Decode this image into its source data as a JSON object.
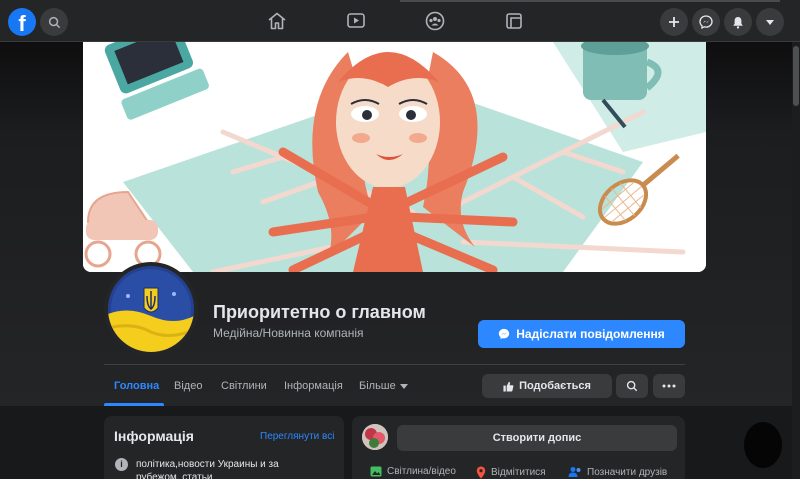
{
  "page": {
    "name": "Приоритетно о главном",
    "category": "Медійна/Новинна компанія",
    "message_button": "Надіслати повідомлення"
  },
  "tabs": [
    {
      "label": "Головна",
      "active": true
    },
    {
      "label": "Відео",
      "active": false
    },
    {
      "label": "Світлини",
      "active": false
    },
    {
      "label": "Інформація",
      "active": false
    },
    {
      "label": "Більше",
      "active": false
    }
  ],
  "actions": {
    "like_label": "Подобається"
  },
  "info": {
    "title": "Інформація",
    "see_all": "Переглянути всі",
    "description": "політика,новости Украины и за рубежом, статьи"
  },
  "composer": {
    "create_post": "Створити допис",
    "photo_video": "Світлина/відео",
    "checkin": "Відмітитися",
    "tag_friends": "Позначити друзів"
  },
  "colors": {
    "accent": "#2d88ff",
    "background": "#18191a",
    "surface": "#242526"
  },
  "icons": [
    "facebook-logo",
    "search-icon",
    "home-icon",
    "watch-icon",
    "groups-icon",
    "gaming-icon",
    "plus-icon",
    "messenger-icon",
    "bell-icon",
    "caret-down-icon",
    "like-icon",
    "ellipsis-icon",
    "info-icon",
    "photo-icon",
    "location-icon",
    "tag-friends-icon"
  ]
}
